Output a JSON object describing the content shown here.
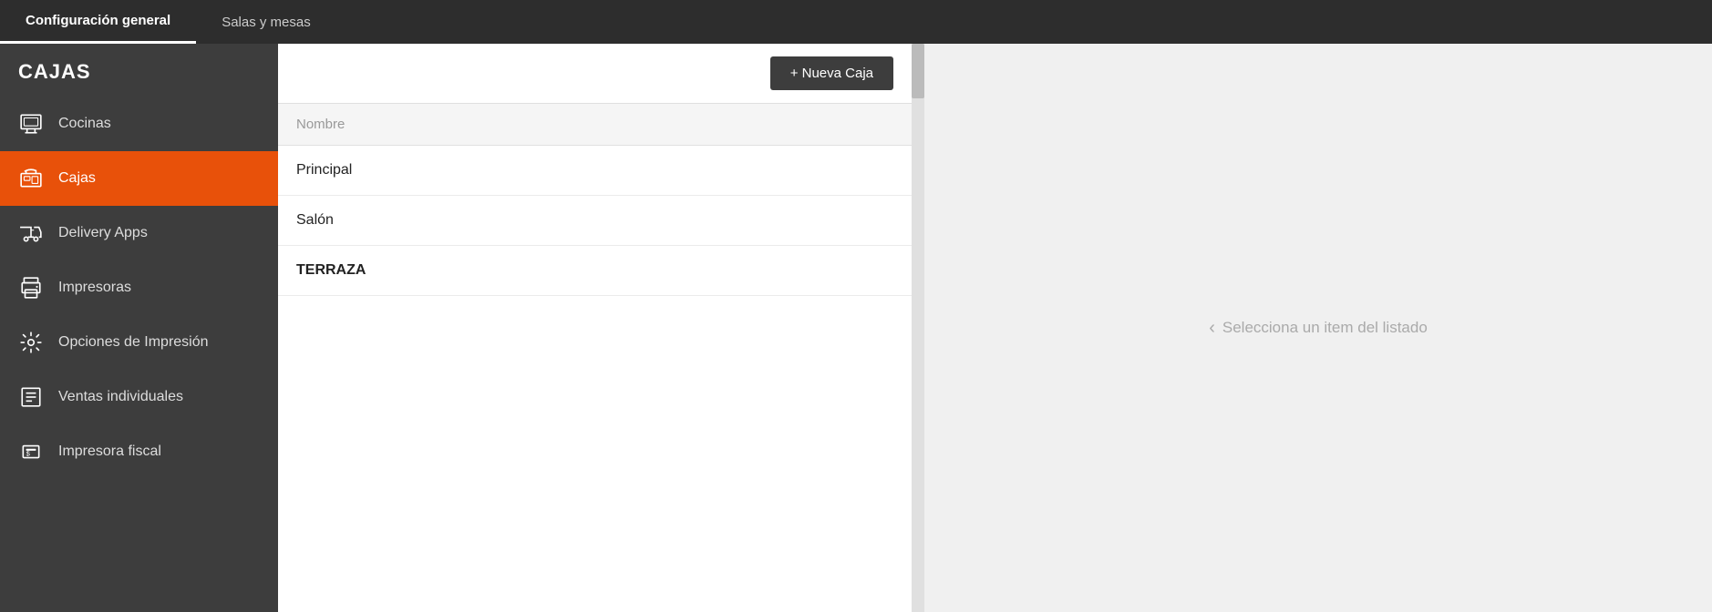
{
  "top_nav": {
    "items": [
      {
        "label": "Configuración general",
        "active": true
      },
      {
        "label": "Salas y mesas",
        "active": false
      }
    ]
  },
  "sidebar": {
    "header": "CAJAS",
    "items": [
      {
        "id": "cocinas",
        "label": "Cocinas",
        "icon": "kitchen"
      },
      {
        "id": "cajas",
        "label": "Cajas",
        "icon": "register",
        "active": true
      },
      {
        "id": "delivery",
        "label": "Delivery Apps",
        "icon": "delivery"
      },
      {
        "id": "impresoras",
        "label": "Impresoras",
        "icon": "printer"
      },
      {
        "id": "opciones-impresion",
        "label": "Opciones de Impresión",
        "icon": "print-options"
      },
      {
        "id": "ventas-individuales",
        "label": "Ventas individuales",
        "icon": "sales"
      },
      {
        "id": "impresora-fiscal",
        "label": "Impresora fiscal",
        "icon": "fiscal-printer"
      }
    ]
  },
  "list_panel": {
    "new_button_label": "+ Nueva Caja",
    "column_header": "Nombre",
    "rows": [
      {
        "label": "Principal",
        "bold": false
      },
      {
        "label": "Salón",
        "bold": false
      },
      {
        "label": "TERRAZA",
        "bold": true
      }
    ]
  },
  "detail_panel": {
    "hint": "Selecciona un item del listado"
  }
}
